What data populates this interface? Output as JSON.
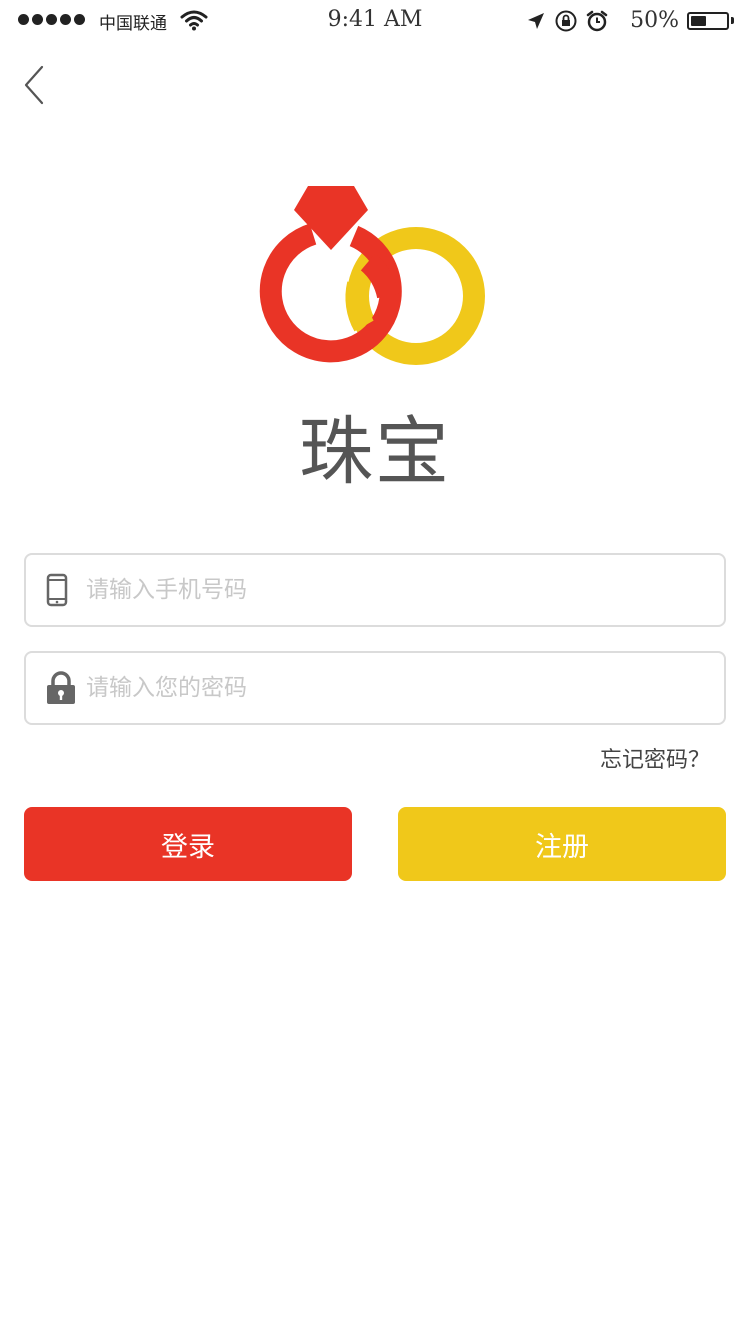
{
  "status_bar": {
    "carrier": "中国联通",
    "time": "9:41 AM",
    "battery_percent": "50%",
    "battery_level": 0.5
  },
  "app": {
    "name": "珠宝"
  },
  "form": {
    "phone_placeholder": "请输入手机号码",
    "password_placeholder": "请输入您的密码",
    "forgot_password": "忘记密码？",
    "login_label": "登录",
    "register_label": "注册"
  },
  "colors": {
    "primary_red": "#e93426",
    "accent_yellow": "#f0c81a",
    "placeholder": "#c8c8c8",
    "icon_gray": "#666666"
  },
  "icons": {
    "back": "chevron-left-icon",
    "phone": "mobile-phone-icon",
    "lock": "lock-icon"
  }
}
